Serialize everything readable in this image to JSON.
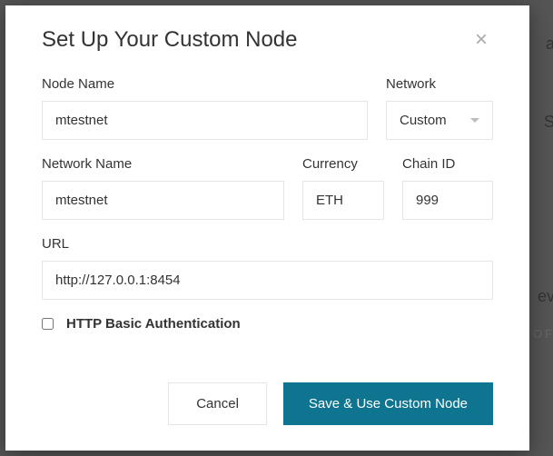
{
  "modal": {
    "title": "Set Up Your Custom Node",
    "close": "×"
  },
  "fields": {
    "node_name": {
      "label": "Node Name",
      "value": "mtestnet"
    },
    "network": {
      "label": "Network",
      "selected": "Custom"
    },
    "network_name": {
      "label": "Network Name",
      "value": "mtestnet"
    },
    "currency": {
      "label": "Currency",
      "value": "ETH"
    },
    "chain_id": {
      "label": "Chain ID",
      "value": "999"
    },
    "url": {
      "label": "URL",
      "value": "http://127.0.0.1:8454"
    },
    "http_auth": {
      "label": "HTTP Basic Authentication",
      "checked": false
    }
  },
  "buttons": {
    "cancel": "Cancel",
    "save": "Save & Use Custom Node"
  },
  "bg": {
    "t1": "a",
    "t2": "S",
    "t3": "ev",
    "t4": "F OF"
  }
}
